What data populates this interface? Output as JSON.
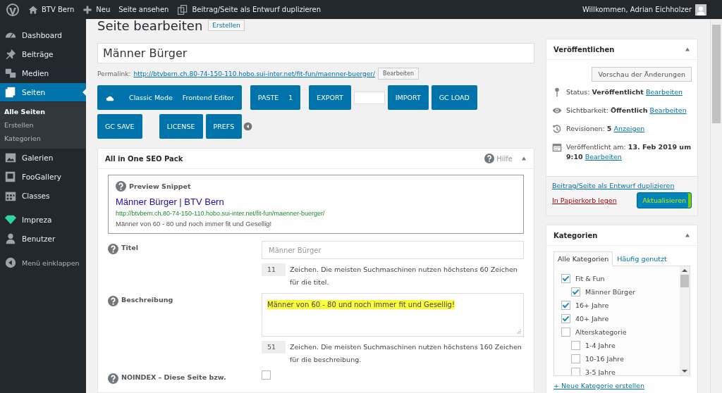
{
  "admin_bar": {
    "site": "BTV Bern",
    "new": "Neu",
    "view": "Seite ansehen",
    "duplicate": "Beitrag/Seite als Entwurf duplizieren",
    "greeting": "Willkommen, Adrian Eichholzer"
  },
  "sidebar": {
    "items": [
      {
        "label": "Dashboard",
        "selected": false
      },
      {
        "label": "Beiträge",
        "selected": false
      },
      {
        "label": "Medien",
        "selected": false
      },
      {
        "label": "Seiten",
        "selected": true,
        "children": [
          {
            "label": "Alle Seiten",
            "selected": true
          },
          {
            "label": "Erstellen",
            "selected": false
          },
          {
            "label": "Kategorien",
            "selected": false
          }
        ]
      },
      {
        "label": "Galerien",
        "selected": false
      },
      {
        "label": "FooGallery",
        "selected": false
      },
      {
        "label": "Classes",
        "selected": false
      },
      {
        "label": "Impreza",
        "selected": false
      },
      {
        "label": "Benutzer",
        "selected": false
      },
      {
        "label": "Menü einklappen",
        "selected": false
      }
    ]
  },
  "editor": {
    "heading": "Seite bearbeiten",
    "add_button": "Erstellen",
    "title_value": "Männer Bürger",
    "permalink_label": "Permalink:",
    "permalink_url": "http://btvbern.ch.80-74-150-110.hobo.sui-inter.net/fit-fun/maenner-buerger/",
    "permalink_button": "Bearbeiten"
  },
  "toolbar": [
    {
      "kind": "group",
      "labels": [
        "Classic Mode",
        "Frontend Editor"
      ]
    },
    {
      "kind": "group",
      "labels": [
        "PASTE",
        "1"
      ]
    },
    {
      "kind": "button",
      "labels": [
        "EXPORT"
      ]
    },
    {
      "kind": "input"
    },
    {
      "kind": "button",
      "labels": [
        "IMPORT"
      ]
    },
    {
      "kind": "button",
      "labels": [
        "GC LOAD"
      ]
    },
    {
      "kind": "button",
      "labels": [
        "GC SAVE"
      ]
    },
    {
      "kind": "button",
      "labels": [
        "LICENSE"
      ]
    },
    {
      "kind": "button",
      "labels": [
        "PREFS"
      ]
    },
    {
      "kind": "toggle"
    }
  ],
  "seo": {
    "title": "All in One SEO Pack",
    "help": "Hilfe",
    "snippet": {
      "heading": "Preview Snippet",
      "title": "Männer Bürger | BTV Bern",
      "url": "http://btvbern.ch.80-74-150-110.hobo.sui-inter.net/fit-fun/maenner-buerger/",
      "description": "Männer von 60 - 80 und noch immer fit und Gesellig!"
    },
    "fields": [
      {
        "kind": "input",
        "label": "Titel",
        "placeholder": "Männer Bürger",
        "count": "11",
        "note": "Zeichen. Die meisten Suchmaschinen nutzen höchstens 60 Zeichen für die titel."
      },
      {
        "kind": "textarea",
        "label": "Beschreibung",
        "value": "Männer von 60 - 80 und noch immer fit und Gesellig!",
        "highlighted": true,
        "count": "51",
        "note": "Zeichen. Die meisten Suchmaschinen nutzen höchstens 160 Zeichen für die beschreibung."
      },
      {
        "kind": "checkbox",
        "label": "NOINDEX – Diese Seite bzw.",
        "checked": false
      }
    ]
  },
  "publish": {
    "title": "Veröffentlichen",
    "preview_button": "Vorschau der Änderungen",
    "rows": [
      {
        "kind": "status",
        "label": "Status:",
        "value": "Veröffentlicht",
        "link": "Bearbeiten"
      },
      {
        "kind": "visibility",
        "label": "Sichtbarkeit:",
        "value": "Öffentlich",
        "link": "Bearbeiten"
      },
      {
        "kind": "revisions",
        "label": "Revisionen:",
        "value": "5",
        "link": "Anzeigen"
      },
      {
        "kind": "date",
        "label": "Veröffentlicht am:",
        "value": "13. Feb 2019 um 9:10",
        "link": "Bearbeiten"
      }
    ],
    "duplicate_link": "Beitrag/Seite als Entwurf duplizieren",
    "trash_link": "In Papierkorb legen",
    "update_button": "Aktualisieren",
    "update_highlighted": true
  },
  "categories": {
    "title": "Kategorien",
    "tabs": [
      {
        "label": "Alle Kategorien",
        "selected": true
      },
      {
        "label": "Häufig genutzt",
        "selected": false
      }
    ],
    "items": [
      {
        "label": "Fit & Fun",
        "checked": true,
        "children": [
          {
            "label": "Männer Bürger",
            "checked": true
          }
        ]
      },
      {
        "label": "16+ Jahre",
        "checked": true
      },
      {
        "label": "40+ Jahre",
        "checked": true
      },
      {
        "label": "Alterskategorie",
        "checked": false,
        "children": [
          {
            "label": "1-4 Jahre",
            "checked": false
          },
          {
            "label": "10-16 Jahre",
            "checked": false
          },
          {
            "label": "3-5 Jahre",
            "checked": false
          }
        ]
      }
    ],
    "add_link": "+ Neue Kategorie erstellen"
  }
}
